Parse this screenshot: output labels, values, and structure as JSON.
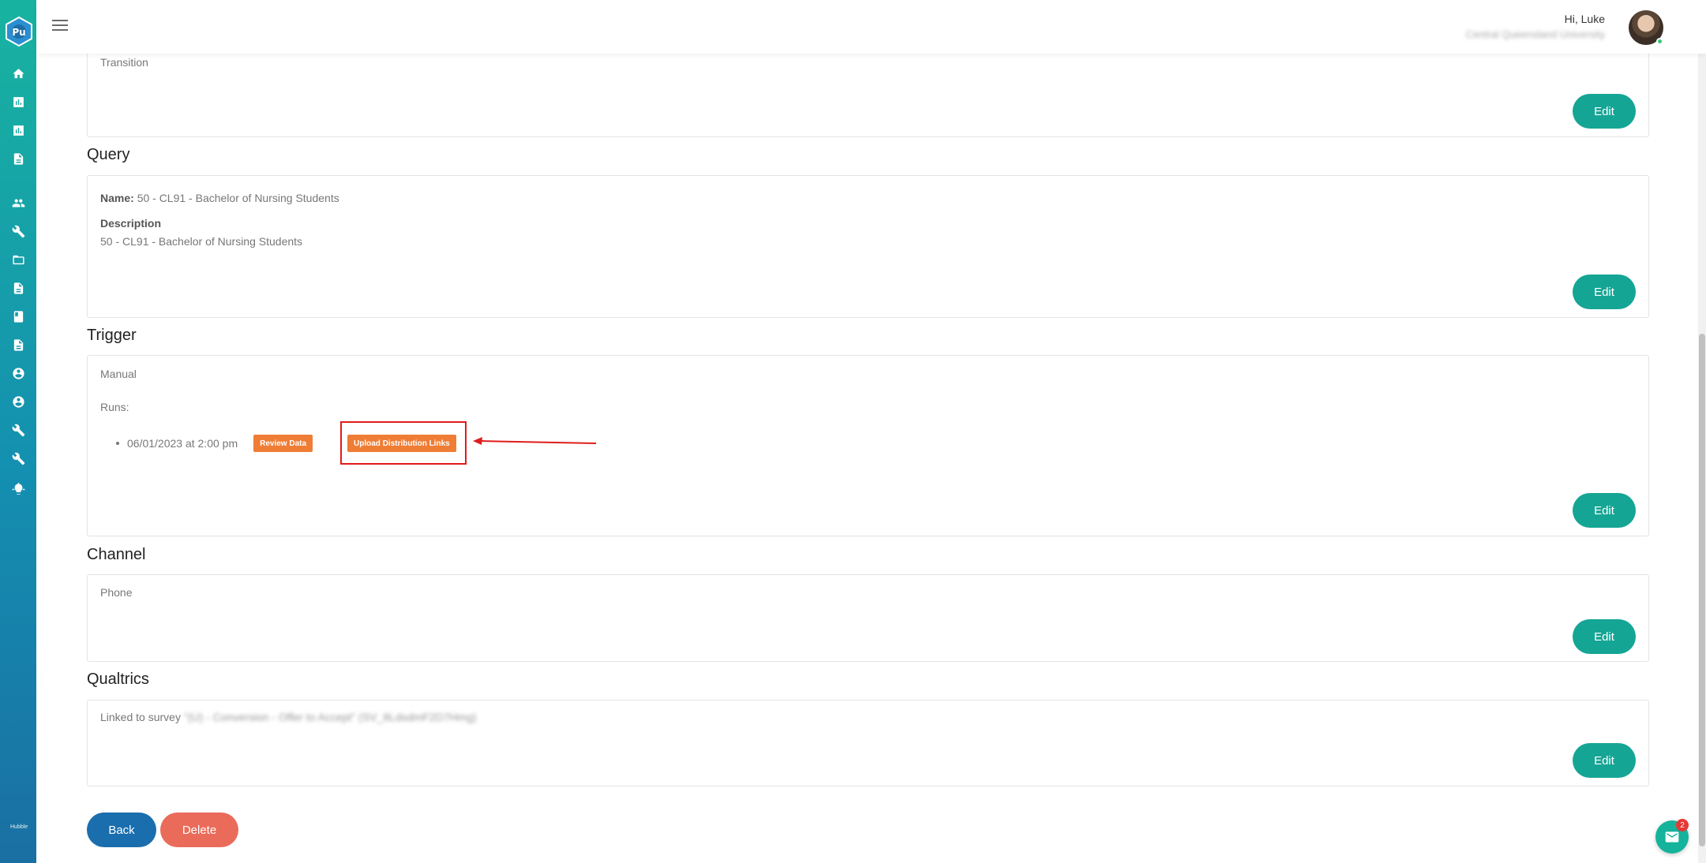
{
  "header": {
    "greeting": "Hi, Luke",
    "organization": "Central Queensland University"
  },
  "sidebar": {
    "icons": [
      "home-icon",
      "bar-chart-icon",
      "bar-chart-icon",
      "document-icon",
      "people-icon",
      "wrench-icon",
      "folder-icon",
      "document-icon",
      "book-icon",
      "document-icon",
      "account-circle-icon",
      "account-circle-icon",
      "wrench-icon",
      "wrench-icon",
      "lightbulb-icon"
    ],
    "footer": "Hubble"
  },
  "sections": {
    "transition": {
      "text": "Transition",
      "edit_label": "Edit"
    },
    "query": {
      "title": "Query",
      "name_label": "Name:",
      "name_value": "50 - CL91 - Bachelor of Nursing Students",
      "description_label": "Description",
      "description_value": "50 - CL91 - Bachelor of Nursing Students",
      "edit_label": "Edit"
    },
    "trigger": {
      "title": "Trigger",
      "mode": "Manual",
      "runs_label": "Runs:",
      "run_datetime": "06/01/2023 at 2:00 pm",
      "review_label": "Review Data",
      "upload_label": "Upload Distribution Links",
      "edit_label": "Edit"
    },
    "channel": {
      "title": "Channel",
      "value": "Phone",
      "edit_label": "Edit"
    },
    "qualtrics": {
      "title": "Qualtrics",
      "linked_prefix": "Linked to survey",
      "survey_name": "\"(U) - Conversion - Offer to Accept\" (SV_8LdsdmF2D7Hmg)",
      "edit_label": "Edit"
    }
  },
  "actions": {
    "back_label": "Back",
    "delete_label": "Delete"
  },
  "chat": {
    "badge_count": "2"
  },
  "colors": {
    "accent": "#15a595",
    "orange": "#ef7d35",
    "primary_blue": "#1a6eae",
    "danger": "#ea6b5a",
    "highlight": "#e01c1c"
  }
}
